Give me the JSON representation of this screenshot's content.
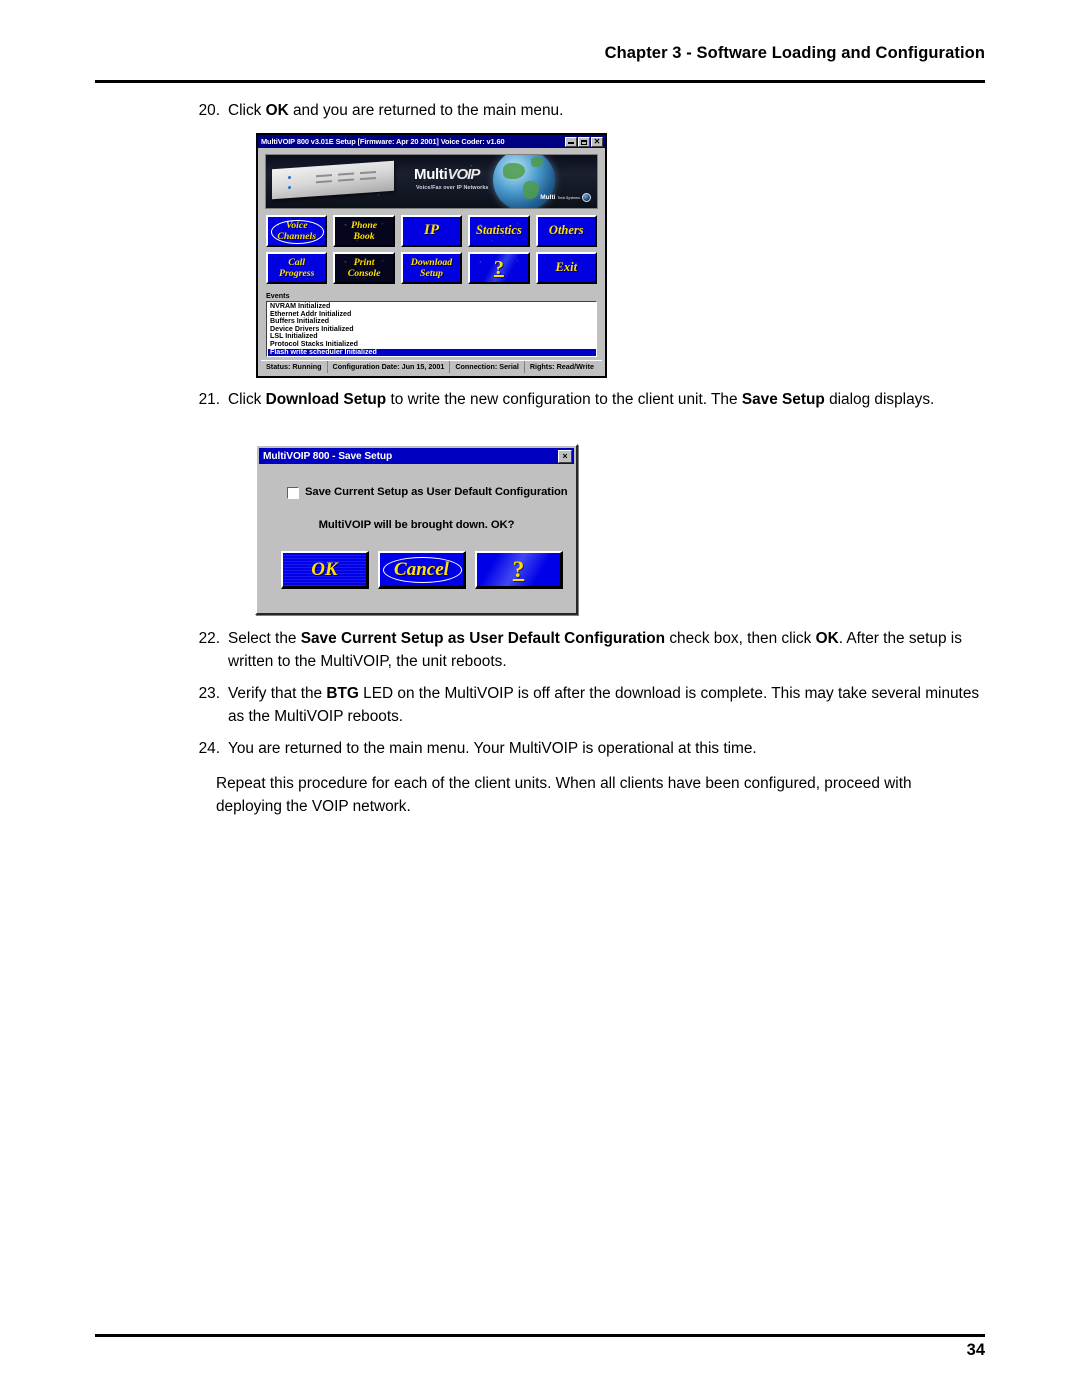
{
  "page": {
    "header": "Chapter 3 - Software Loading and Configuration",
    "number": "34"
  },
  "steps": {
    "s20": {
      "num": "20.",
      "a": "Click ",
      "b1": "OK",
      "c": " and you are returned to the main menu."
    },
    "s21": {
      "num": "21.",
      "a": "Click ",
      "b1": "Download Setup",
      "c": " to write the new configuration to the client unit.  The ",
      "b2": "Save Setup",
      "d": " dialog displays."
    },
    "s22": {
      "num": "22.",
      "a": "Select the ",
      "b1": "Save Current Setup as User Default Configuration",
      "c": " check box, then click ",
      "b2": "OK",
      "d": ".  After the setup is written to the MultiVOIP, the unit reboots."
    },
    "s23": {
      "num": "23.",
      "a": "Verify that the ",
      "b1": "BTG",
      "c": " LED on the MultiVOIP is off after the download is complete.  This may take several minutes as the MultiVOIP reboots."
    },
    "s24": {
      "num": "24.",
      "a": "You are returned to the main menu.  Your MultiVOIP is operational at this time."
    },
    "closing": "Repeat this procedure for each of the client units.  When all clients have been configured, proceed with deploying the VOIP network."
  },
  "main_window": {
    "title": "MultiVOIP 800 v3.01E Setup [Firmware: Apr 20 2001] Voice Coder: v1.60",
    "window_buttons": {
      "minimize": "minimize-button",
      "maximize": "maximize-button",
      "close": "close-button"
    },
    "banner": {
      "logo_multi": "Multi",
      "logo_voip": "VOIP",
      "tagline": "Voice/Fax over IP Networks",
      "corp_name": "Multi",
      "corp_sub": "Tech\nSystems"
    },
    "buttons": [
      {
        "id": "voice-channels",
        "line1": "Voice",
        "line2": "Channels",
        "focused": true,
        "style": "speckle"
      },
      {
        "id": "phone-book",
        "line1": "Phone",
        "line2": "Book",
        "focused": false,
        "style": "dark"
      },
      {
        "id": "ip",
        "line1": "IP",
        "line2": "",
        "focused": false,
        "style": "plain"
      },
      {
        "id": "statistics",
        "line1": "Statistics",
        "line2": "",
        "focused": false,
        "style": "speckle"
      },
      {
        "id": "others",
        "line1": "Others",
        "line2": "",
        "focused": false,
        "style": "plain"
      },
      {
        "id": "call-progress",
        "line1": "Call",
        "line2": "Progress",
        "focused": false,
        "style": "plain"
      },
      {
        "id": "print-console",
        "line1": "Print",
        "line2": "Console",
        "focused": false,
        "style": "dark"
      },
      {
        "id": "download-setup",
        "line1": "Download",
        "line2": "Setup",
        "focused": false,
        "style": "speckle"
      },
      {
        "id": "help",
        "line1": "?",
        "line2": "",
        "focused": false,
        "style": "speckle"
      },
      {
        "id": "exit",
        "line1": "Exit",
        "line2": "",
        "focused": false,
        "style": "plain"
      }
    ],
    "events": {
      "legend": "Events",
      "items": [
        {
          "text": "NVRAM Initialized",
          "selected": false
        },
        {
          "text": "Ethernet Addr Initialized",
          "selected": false
        },
        {
          "text": "Buffers Initialized",
          "selected": false
        },
        {
          "text": "Device Drivers Initialized",
          "selected": false
        },
        {
          "text": "LSL Initialized",
          "selected": false
        },
        {
          "text": "Protocol Stacks Initialized",
          "selected": false
        },
        {
          "text": "Flash write scheduler Initialized",
          "selected": true
        }
      ]
    },
    "status": {
      "status": "Status: Running",
      "config_date": "Configuration Date: Jun 15, 2001",
      "connection": "Connection: Serial",
      "rights": "Rights: Read/Write"
    }
  },
  "save_dialog": {
    "title": "MultiVOIP 800 - Save Setup",
    "close_glyph": "×",
    "checkbox_label": "Save Current Setup as User Default Configuration",
    "checkbox_checked": false,
    "message": "MultiVOIP will be brought down. OK?",
    "buttons": [
      {
        "id": "ok",
        "label": "OK",
        "focused": false
      },
      {
        "id": "cancel",
        "label": "Cancel",
        "focused": true
      },
      {
        "id": "help",
        "label": "?",
        "focused": false
      }
    ]
  },
  "colors": {
    "titlebar_blue": "#000082",
    "button_blue": "#0000e0",
    "button_yellow": "#ffe000",
    "dialog_gray": "#c0c0c0",
    "selection_blue": "#0000c8"
  }
}
